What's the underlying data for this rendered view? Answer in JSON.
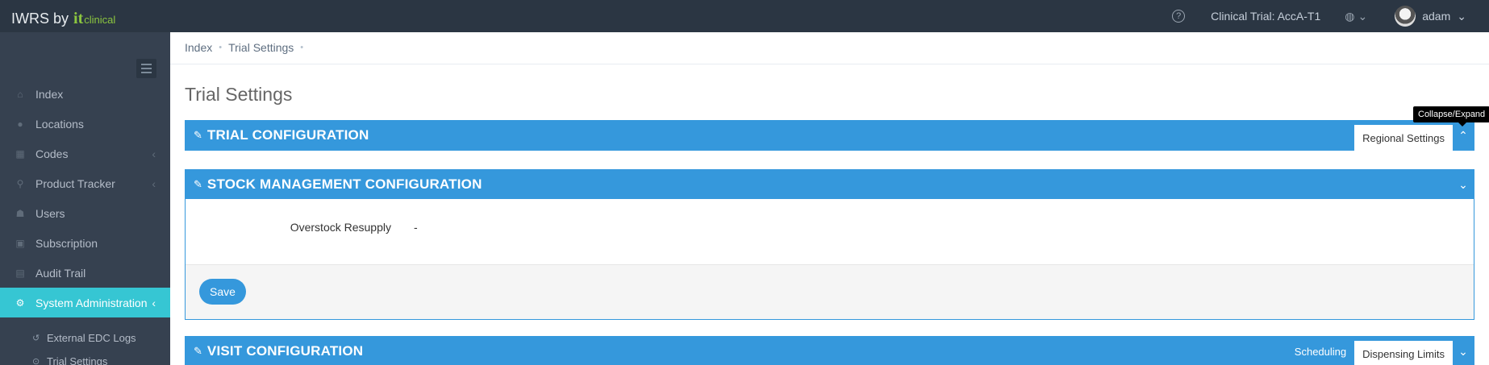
{
  "brand": {
    "prefix": "IWRS by",
    "it": "it",
    "clinical": "clinical"
  },
  "topbar": {
    "help": "?",
    "trial": "Clinical Trial: AccA-T1",
    "globe": "🌐",
    "user": "adam"
  },
  "sidebar": {
    "items": [
      {
        "label": "Index",
        "icon": "home-icon",
        "glyph": "⌂"
      },
      {
        "label": "Locations",
        "icon": "globe-icon",
        "glyph": "●"
      },
      {
        "label": "Codes",
        "icon": "barcode-icon",
        "glyph": "▦"
      },
      {
        "label": "Product Tracker",
        "icon": "map-pin-icon",
        "glyph": "⚲"
      },
      {
        "label": "Users",
        "icon": "users-icon",
        "glyph": "👥"
      },
      {
        "label": "Subscription",
        "icon": "archive-icon",
        "glyph": "▣"
      },
      {
        "label": "Audit Trail",
        "icon": "book-icon",
        "glyph": "▤"
      },
      {
        "label": "System Administration",
        "icon": "cogs-icon",
        "glyph": "⚙"
      }
    ],
    "subitems": [
      {
        "label": "External EDC Logs",
        "glyph": "↺"
      },
      {
        "label": "Trial Settings",
        "glyph": "⊙"
      }
    ]
  },
  "breadcrumb": {
    "index": "Index",
    "current": "Trial Settings",
    "sep": "•"
  },
  "page": {
    "title": "Trial Settings"
  },
  "panels": {
    "trial": {
      "title": "TRIAL CONFIGURATION",
      "tab": "Regional Settings"
    },
    "stock": {
      "title": "STOCK MANAGEMENT CONFIGURATION",
      "field_label": "Overstock Resupply",
      "field_value": "-",
      "save": "Save"
    },
    "visit": {
      "title": "VISIT CONFIGURATION",
      "tab1": "Scheduling",
      "tab2": "Dispensing Limits"
    }
  },
  "tooltip": "Collapse/Expand",
  "colors": {
    "accent": "#3598dc",
    "active": "#36c6d3",
    "sidebar": "#364150",
    "topbar": "#2b3643"
  }
}
